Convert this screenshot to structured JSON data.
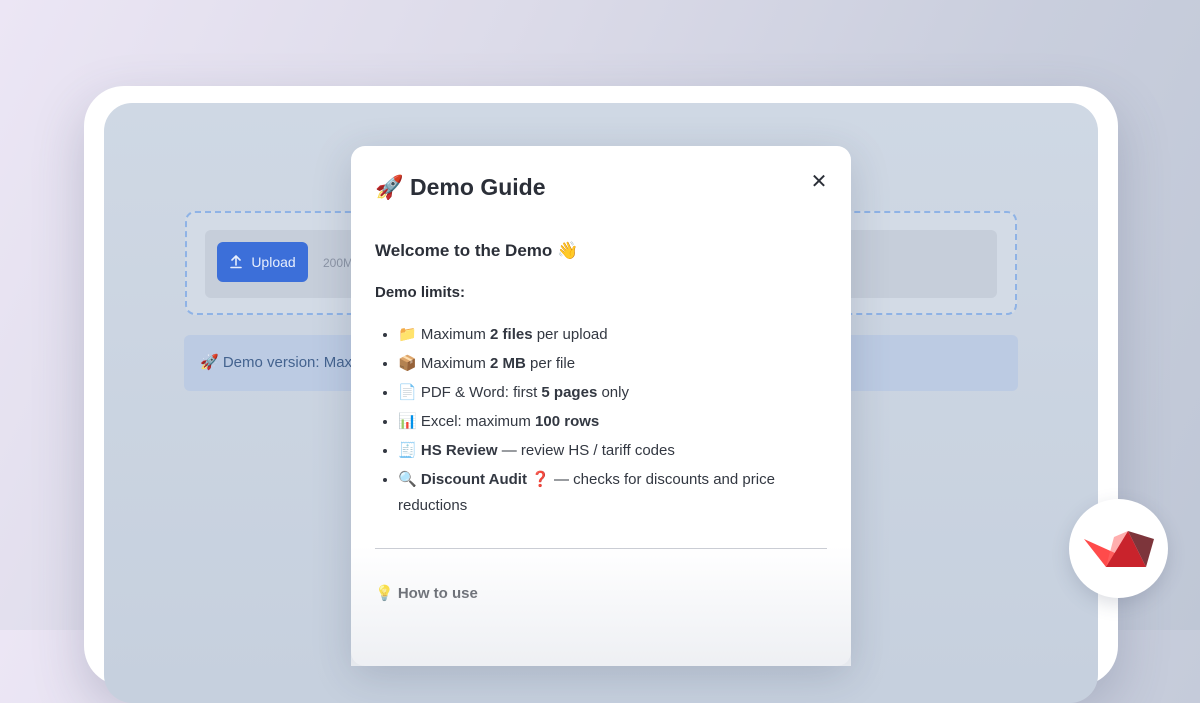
{
  "background_app": {
    "upload_label": "Upload",
    "upload_icon": "upload-icon",
    "size_hint": "200M",
    "info_banner": "🚀  Demo version: Max"
  },
  "modal": {
    "title": "🚀 Demo Guide",
    "close_label": "✕",
    "welcome": "Welcome to the Demo 👋",
    "limits_label": "Demo limits:",
    "limits": [
      {
        "prefix": "📁 Maximum ",
        "bold": "2 files",
        "suffix": " per upload"
      },
      {
        "prefix": "📦 Maximum ",
        "bold": "2 MB",
        "suffix": " per file"
      },
      {
        "prefix": "📄 PDF & Word: first ",
        "bold": "5 pages",
        "suffix": " only"
      },
      {
        "prefix": "📊 Excel: maximum ",
        "bold": "100 rows",
        "suffix": ""
      },
      {
        "prefix": "🧾 ",
        "bold": "HS Review",
        "suffix": " — review HS / tariff codes"
      },
      {
        "prefix": "🔍 ",
        "bold": "Discount Audit",
        "suffix": " ❓ — checks for discounts and price reductions"
      }
    ],
    "how_to_use": "💡 How to use"
  },
  "colors": {
    "accent": "#3c6fd9",
    "logo_red": "#e8343f"
  },
  "icons": {
    "logo": "streamlit-boat-logo"
  }
}
